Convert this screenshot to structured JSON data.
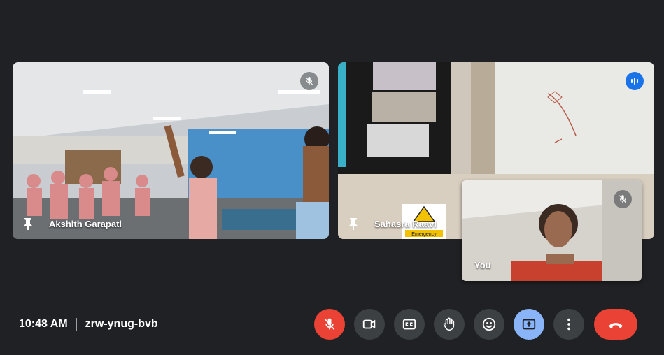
{
  "participants": [
    {
      "name": "Akshith Garapati",
      "muted": true
    },
    {
      "name": "Sahasra Raavi",
      "speaking": true
    },
    {
      "name": "You",
      "muted": true
    }
  ],
  "meeting": {
    "time": "10:48 AM",
    "code": "zrw-ynug-bvb"
  },
  "sign_text": "Emergency",
  "controls": {
    "colors": {
      "danger": "#ea4335",
      "neutral": "#3c4043",
      "active": "#8ab4f8",
      "speaking": "#1a73e8"
    },
    "icons": [
      "mic-off-icon",
      "camera-icon",
      "captions-icon",
      "raise-hand-icon",
      "emoji-icon",
      "present-screen-icon",
      "more-options-icon",
      "end-call-icon"
    ]
  }
}
